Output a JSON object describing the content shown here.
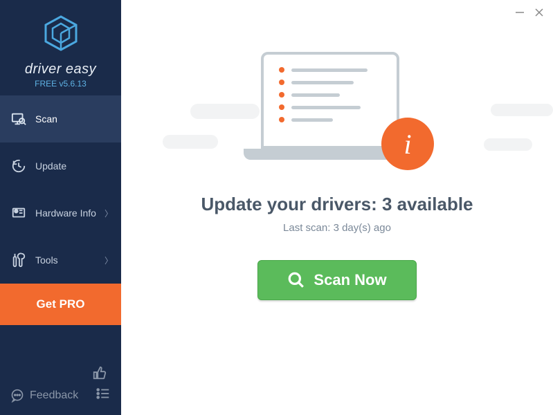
{
  "brand": {
    "name": "driver easy",
    "version_label": "FREE v5.6.13"
  },
  "sidebar": {
    "items": [
      {
        "label": "Scan"
      },
      {
        "label": "Update"
      },
      {
        "label": "Hardware Info"
      },
      {
        "label": "Tools"
      }
    ],
    "get_pro_label": "Get PRO",
    "feedback_label": "Feedback"
  },
  "main": {
    "headline": "Update your drivers: 3 available",
    "subline": "Last scan: 3 day(s) ago",
    "scan_button_label": "Scan Now"
  }
}
